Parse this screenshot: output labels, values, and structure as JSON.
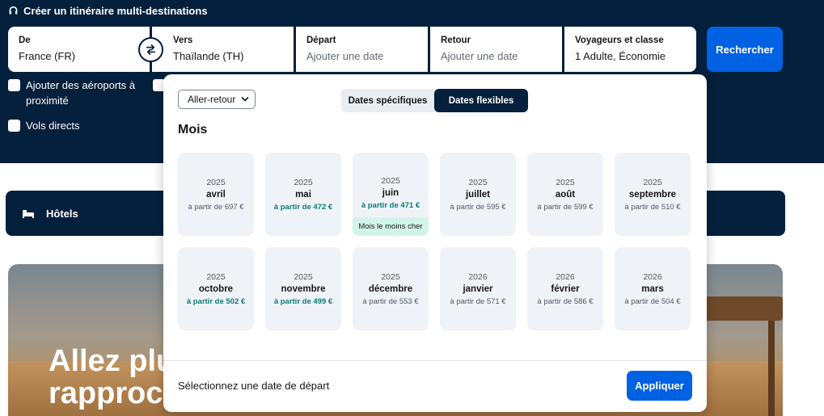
{
  "header": {
    "multi_destination_link": "Créer un itinéraire multi-destinations"
  },
  "search": {
    "from": {
      "label": "De",
      "value": "France (FR)"
    },
    "to": {
      "label": "Vers",
      "value": "Thaïlande (TH)"
    },
    "depart": {
      "label": "Départ",
      "placeholder": "Ajouter une date"
    },
    "return": {
      "label": "Retour",
      "placeholder": "Ajouter une date"
    },
    "travellers": {
      "label": "Voyageurs et classe",
      "value": "1 Adulte, Économie"
    },
    "search_button": "Rechercher"
  },
  "options": {
    "nearby_airports": "Ajouter des aéroports à proximité",
    "direct_flights": "Vols directs"
  },
  "hotels_bar": {
    "label": "Hôtels"
  },
  "promo": {
    "title_visible": "Allez plus\nrapproch"
  },
  "date_picker": {
    "trip_type": "Aller-retour",
    "tabs": {
      "specific": "Dates spécifiques",
      "flexible": "Dates flexibles",
      "active": "flexible"
    },
    "section_title": "Mois",
    "cheapest_badge": "Mois le moins cher",
    "months": [
      {
        "year": "2025",
        "month": "avril",
        "price": "à partir de 697 €",
        "highlight": false
      },
      {
        "year": "2025",
        "month": "mai",
        "price": "à partir de 472 €",
        "highlight": true
      },
      {
        "year": "2025",
        "month": "juin",
        "price": "à partir de 471 €",
        "highlight": true,
        "cheapest": true
      },
      {
        "year": "2025",
        "month": "juillet",
        "price": "à partir de 595 €",
        "highlight": false
      },
      {
        "year": "2025",
        "month": "août",
        "price": "à partir de 599 €",
        "highlight": false
      },
      {
        "year": "2025",
        "month": "septembre",
        "price": "à partir de 510 €",
        "highlight": false
      },
      {
        "year": "2025",
        "month": "octobre",
        "price": "à partir de 502 €",
        "highlight": true
      },
      {
        "year": "2025",
        "month": "novembre",
        "price": "à partir de 499 €",
        "highlight": true
      },
      {
        "year": "2025",
        "month": "décembre",
        "price": "à partir de 553 €",
        "highlight": false
      },
      {
        "year": "2026",
        "month": "janvier",
        "price": "à partir de 571 €",
        "highlight": false
      },
      {
        "year": "2026",
        "month": "février",
        "price": "à partir de 586 €",
        "highlight": false
      },
      {
        "year": "2026",
        "month": "mars",
        "price": "à partir de 504 €",
        "highlight": false
      }
    ],
    "footer_text": "Sélectionnez une date de départ",
    "apply_button": "Appliquer"
  },
  "colors": {
    "navy": "#05203c",
    "blue": "#0062e3",
    "teal": "#0b7c75",
    "badge": "#d2f5ea"
  }
}
